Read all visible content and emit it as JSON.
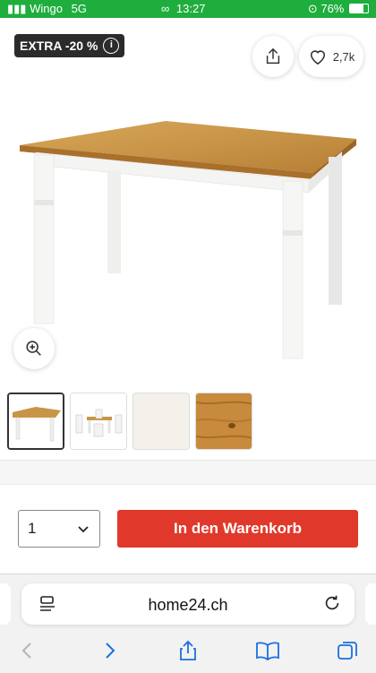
{
  "status_bar": {
    "carrier": "Wingo",
    "network": "5G",
    "time": "13:27",
    "battery": "76%"
  },
  "product": {
    "badge_label": "EXTRA -20 %",
    "badge_info_glyph": "i",
    "like_count": "2,7k",
    "icons": [
      "share-icon",
      "heart-icon",
      "zoom-in-icon"
    ]
  },
  "purchase": {
    "quantity": "1",
    "add_to_cart_label": "In den Warenkorb",
    "accent_color": "#e0392b"
  },
  "browser": {
    "url": "home24.ch",
    "toolbar_icons": [
      "back-icon",
      "forward-icon",
      "share-icon",
      "bookmarks-icon",
      "tabs-icon"
    ],
    "accent_color": "#1a6fe0"
  }
}
